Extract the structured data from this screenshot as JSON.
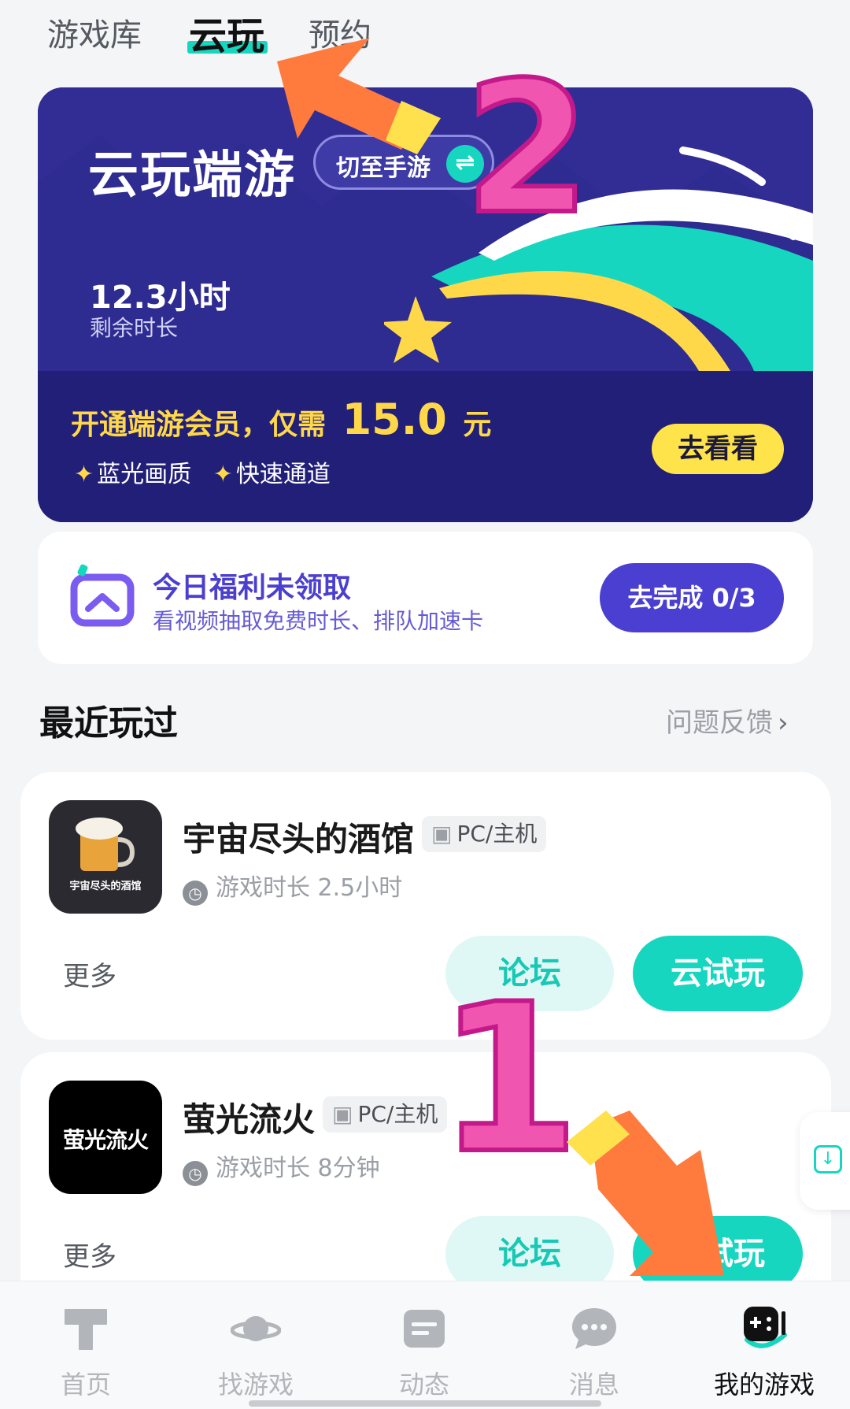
{
  "top_tabs": {
    "library": "游戏库",
    "cloud": "云玩",
    "reserve": "预约"
  },
  "banner": {
    "title": "云玩端游",
    "switch_label": "切至手游",
    "switch_icon": "⇌",
    "hours_value": "12.3小时",
    "hours_label": "剩余时长",
    "vip_prefix": "开通端游会员，仅需",
    "vip_price": "15.0",
    "vip_unit": "元",
    "perk_1": "蓝光画质",
    "perk_2": "快速通道",
    "see_button": "去看看"
  },
  "welfare": {
    "title": "今日福利未领取",
    "subtitle": "看视频抽取免费时长、排队加速卡",
    "button": "去完成 0/3"
  },
  "section": {
    "title": "最近玩过",
    "feedback": "问题反馈"
  },
  "games": [
    {
      "name": "宇宙尽头的酒馆",
      "platform": "PC/主机",
      "playtime": "游戏时长 2.5小时",
      "more": "更多",
      "forum": "论坛",
      "trial": "云试玩",
      "cover_text": "宇宙尽头的酒馆"
    },
    {
      "name": "萤光流火",
      "platform": "PC/主机",
      "playtime": "游戏时长 8分钟",
      "more": "更多",
      "forum": "论坛",
      "trial": "云试玩",
      "cover_text": "萤光流火"
    }
  ],
  "bottom_nav": [
    {
      "label": "首页",
      "icon": "home-t-icon"
    },
    {
      "label": "找游戏",
      "icon": "planet-icon"
    },
    {
      "label": "动态",
      "icon": "feed-icon"
    },
    {
      "label": "消息",
      "icon": "chat-bubble-icon"
    },
    {
      "label": "我的游戏",
      "icon": "gamepad-icon"
    }
  ],
  "annotations": {
    "step_1": "1",
    "step_2": "2"
  },
  "colors": {
    "accent_teal": "#17d6c0",
    "banner_purple": "#312d94",
    "banner_dark": "#221f78",
    "vip_yellow": "#ffd84a",
    "welfare_purple": "#4a3fd0",
    "annotation_pink": "#f055b0",
    "annotation_orange": "#ff7a3d"
  }
}
